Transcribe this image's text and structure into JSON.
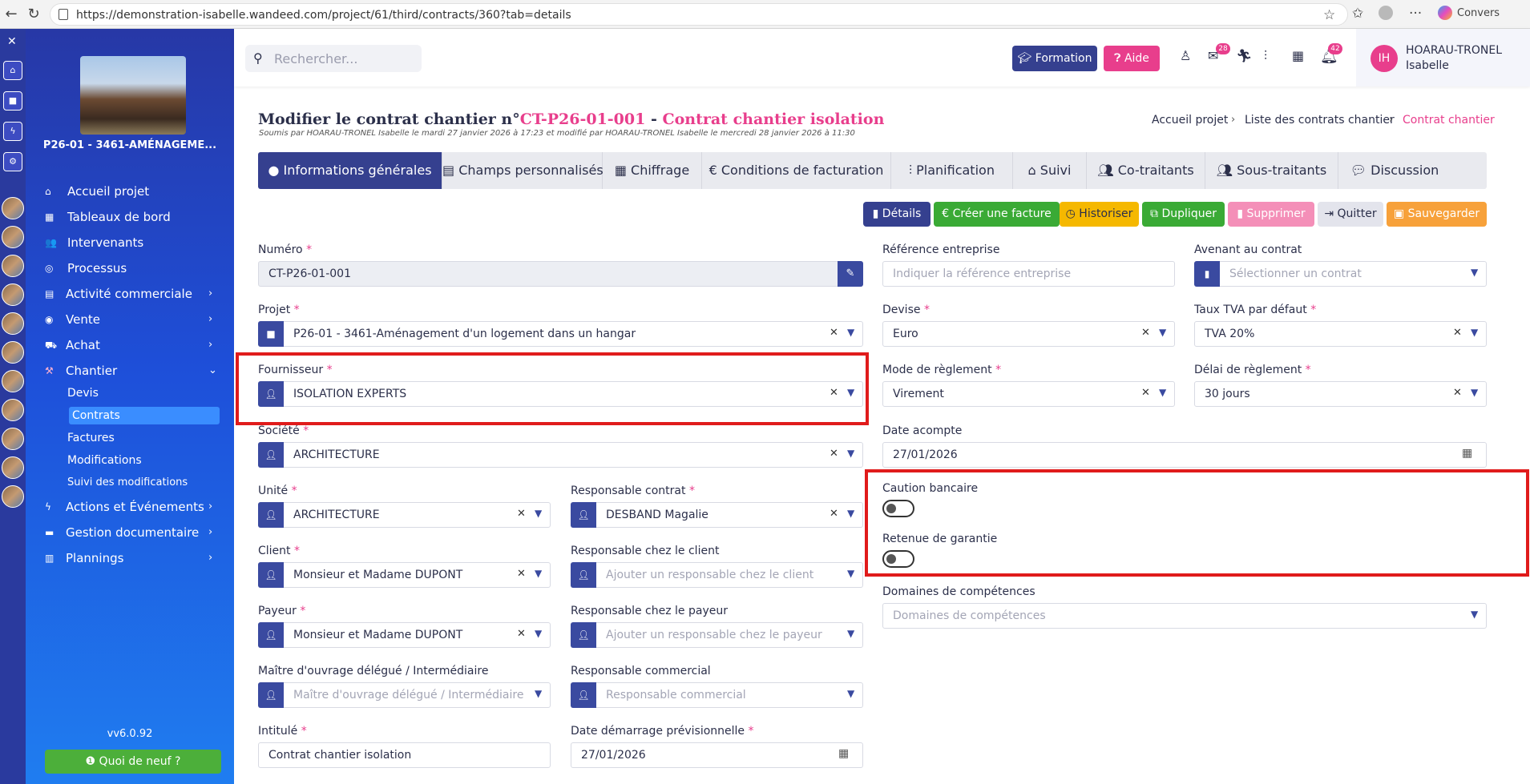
{
  "browser": {
    "url": "https://demonstration-isabelle.wandeed.com/project/61/third/contracts/360?tab=details",
    "copilot_label": "Convers"
  },
  "sidebar": {
    "project_name": "P26-01 - 3461-AMÉNAGEME...",
    "items": [
      {
        "label": "Accueil projet",
        "icon": "home-icon"
      },
      {
        "label": "Tableaux de bord",
        "icon": "dashboard-icon"
      },
      {
        "label": "Intervenants",
        "icon": "users-icon"
      },
      {
        "label": "Processus",
        "icon": "process-icon"
      },
      {
        "label": "Activité commerciale",
        "icon": "document-icon"
      },
      {
        "label": "Vente",
        "icon": "target-icon"
      },
      {
        "label": "Achat",
        "icon": "cart-icon"
      },
      {
        "label": "Chantier",
        "icon": "crane-icon"
      }
    ],
    "chantier_sub": [
      "Devis",
      "Contrats",
      "Factures",
      "Modifications",
      "Suivi des modifications"
    ],
    "items_bottom": [
      {
        "label": "Actions et Événements",
        "icon": "bolt-icon"
      },
      {
        "label": "Gestion documentaire",
        "icon": "folder-icon"
      },
      {
        "label": "Plannings",
        "icon": "chart-icon"
      }
    ],
    "version": "vv6.0.92",
    "news_button": "Quoi de neuf ?"
  },
  "header": {
    "search_placeholder": "Rechercher...",
    "formation": "Formation",
    "aide": "Aide",
    "mail_badge": "28",
    "notif_badge": "42",
    "user_initials": "IH",
    "user_lastname": "HOARAU-TRONEL",
    "user_firstname": "Isabelle"
  },
  "page": {
    "title_prefix": "Modifier le contrat chantier n°",
    "title_number": "CT-P26-01-001",
    "title_sep": " - ",
    "title_name": "Contrat chantier isolation",
    "subtitle": "Soumis par HOARAU-TRONEL Isabelle le mardi 27 janvier 2026 à 17:23 et modifié par HOARAU-TRONEL Isabelle le mercredi 28 janvier 2026 à 11:30",
    "breadcrumb": [
      "Accueil projet",
      "Liste des contrats chantier",
      "Contrat chantier"
    ]
  },
  "tabs": [
    {
      "label": "Informations générales",
      "icon": "info-icon"
    },
    {
      "label": "Champs personnalisés",
      "icon": "list-icon"
    },
    {
      "label": "Chiffrage",
      "icon": "calculator-icon"
    },
    {
      "label": "Conditions de facturation",
      "icon": "euro-icon"
    },
    {
      "label": "Planification",
      "icon": "planning-icon"
    },
    {
      "label": "Suivi",
      "icon": "suivi-icon"
    },
    {
      "label": "Co-traitants",
      "icon": "people-icon"
    },
    {
      "label": "Sous-traitants",
      "icon": "people-icon"
    },
    {
      "label": "Discussion",
      "icon": "chat-icon"
    }
  ],
  "actions": {
    "details": "Détails",
    "facture": "Créer une facture",
    "historiser": "Historiser",
    "dupliquer": "Dupliquer",
    "supprimer": "Supprimer",
    "quitter": "Quitter",
    "sauvegarder": "Sauvegarder",
    "colors": {
      "details": "#35408f",
      "facture": "#3aaa35",
      "historiser": "#f5b800",
      "dupliquer": "#3aaa35",
      "supprimer": "#f48fb8",
      "quitter": "#e3e4ec",
      "sauvegarder": "#f7a13a"
    }
  },
  "form": {
    "numero": {
      "label": "Numéro",
      "value": "CT-P26-01-001"
    },
    "projet": {
      "label": "Projet",
      "value": "P26-01 - 3461-Aménagement d'un logement dans un hangar"
    },
    "fournisseur": {
      "label": "Fournisseur",
      "value": "ISOLATION EXPERTS"
    },
    "societe": {
      "label": "Société",
      "value": "ARCHITECTURE"
    },
    "unite": {
      "label": "Unité",
      "value": "ARCHITECTURE"
    },
    "resp_contrat": {
      "label": "Responsable contrat",
      "value": "DESBAND Magalie"
    },
    "client": {
      "label": "Client",
      "value": "Monsieur et Madame DUPONT"
    },
    "resp_client": {
      "label": "Responsable chez le client",
      "placeholder": "Ajouter un responsable chez le client"
    },
    "payeur": {
      "label": "Payeur",
      "value": "Monsieur et Madame DUPONT"
    },
    "resp_payeur": {
      "label": "Responsable chez le payeur",
      "placeholder": "Ajouter un responsable chez le payeur"
    },
    "moa": {
      "label": "Maître d'ouvrage délégué / Intermédiaire",
      "placeholder": "Maître d'ouvrage délégué / Intermédiaire"
    },
    "resp_commercial": {
      "label": "Responsable commercial",
      "placeholder": "Responsable commercial"
    },
    "intitule": {
      "label": "Intitulé",
      "value": "Contrat chantier isolation"
    },
    "date_demarrage": {
      "label": "Date démarrage prévisionnelle",
      "value": "27/01/2026"
    },
    "ref_entreprise": {
      "label": "Référence entreprise",
      "placeholder": "Indiquer la référence entreprise"
    },
    "avenant": {
      "label": "Avenant au contrat",
      "placeholder": "Sélectionner un contrat"
    },
    "devise": {
      "label": "Devise",
      "value": "Euro"
    },
    "tva": {
      "label": "Taux TVA par défaut",
      "value": "TVA 20%"
    },
    "mode_reglement": {
      "label": "Mode de règlement",
      "value": "Virement"
    },
    "delai_reglement": {
      "label": "Délai de règlement",
      "value": "30 jours"
    },
    "date_acompte": {
      "label": "Date acompte",
      "value": "27/01/2026"
    },
    "caution": {
      "label": "Caution bancaire",
      "on": false
    },
    "retenue": {
      "label": "Retenue de garantie",
      "on": false
    },
    "domaines": {
      "label": "Domaines de compétences",
      "placeholder": "Domaines de compétences"
    },
    "required_mark": "*"
  }
}
